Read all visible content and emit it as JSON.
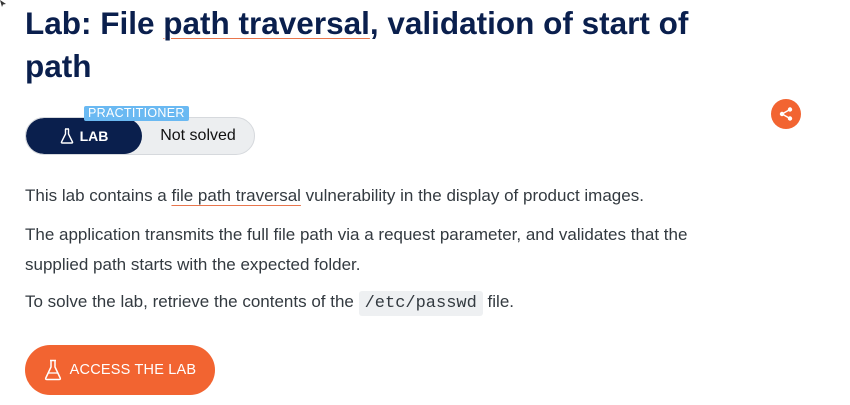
{
  "title": {
    "prefix": "Lab: File ",
    "link": "path traversal",
    "suffix": ", validation of start of path"
  },
  "badge": {
    "level": "PRACTITIONER",
    "lab_label": "LAB",
    "status": "Not solved",
    "icon": "flask-icon"
  },
  "share": {
    "icon": "share-icon",
    "color": "#f26431"
  },
  "description": {
    "p1_before": "This lab contains a ",
    "p1_link": "file path traversal",
    "p1_after": " vulnerability in the display of product images.",
    "p2": "The application transmits the full file path via a request parameter, and validates that the supplied path starts with the expected folder.",
    "p3_before": "To solve the lab, retrieve the contents of the ",
    "p3_code": "/etc/passwd",
    "p3_after": " file."
  },
  "access_button": {
    "label": "ACCESS THE LAB",
    "icon": "flask-icon"
  },
  "colors": {
    "navy": "#0a1f4d",
    "orange": "#f26431",
    "practitioner_blue": "#6ab9f2",
    "text": "#333a40"
  }
}
